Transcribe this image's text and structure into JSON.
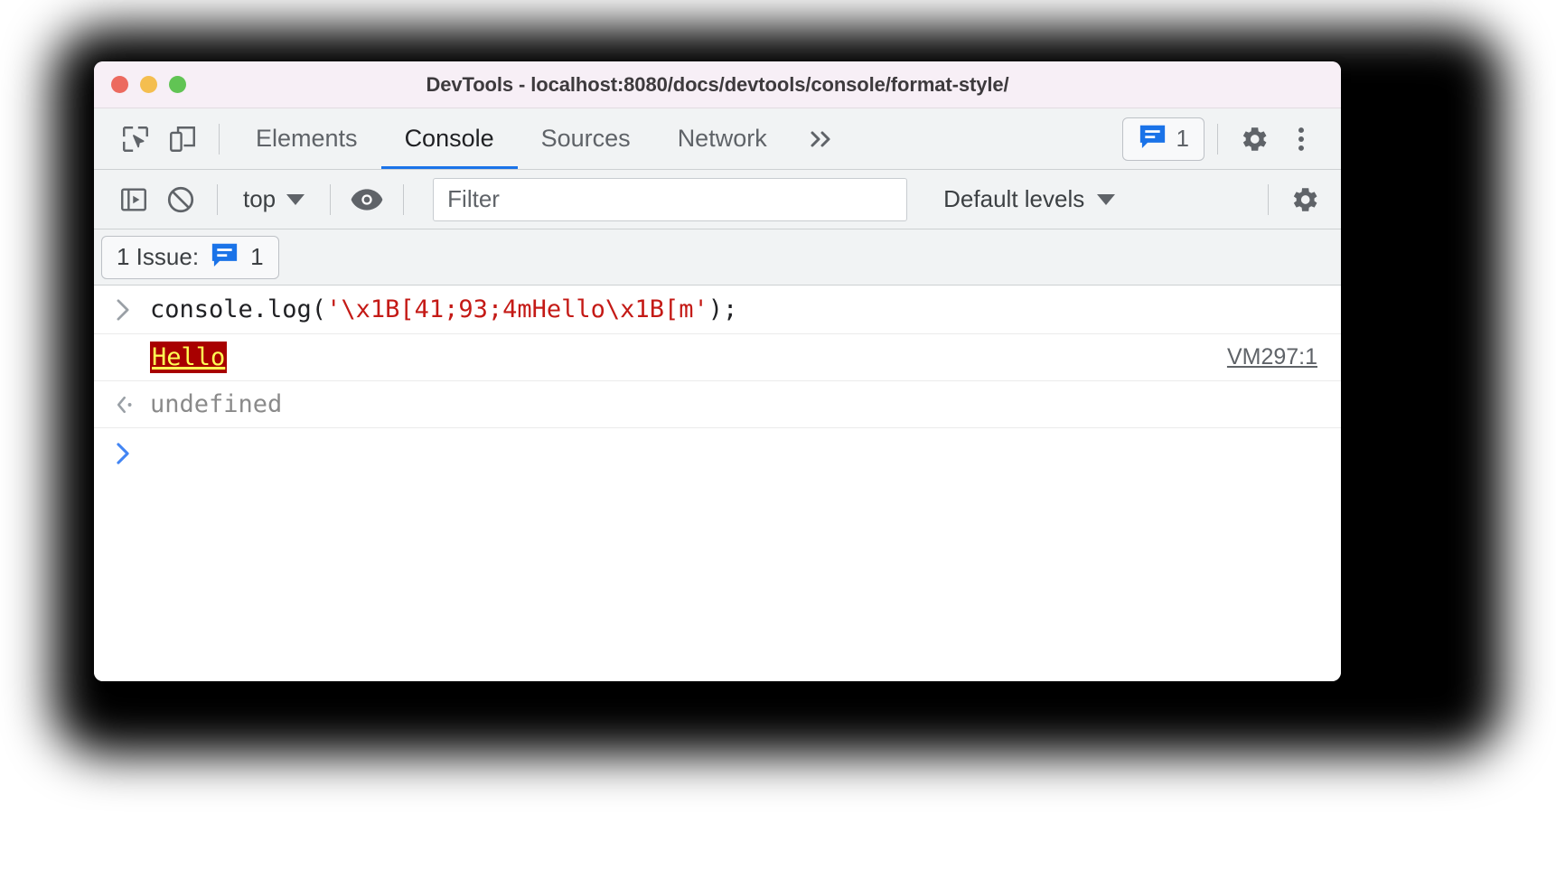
{
  "window": {
    "title": "DevTools - localhost:8080/docs/devtools/console/format-style/",
    "traffic_lights": [
      "close",
      "minimize",
      "maximize"
    ]
  },
  "tabbar": {
    "inspect_icon": "inspect-element-icon",
    "device_icon": "device-toolbar-icon",
    "tabs": [
      {
        "label": "Elements",
        "active": false
      },
      {
        "label": "Console",
        "active": true
      },
      {
        "label": "Sources",
        "active": false
      },
      {
        "label": "Network",
        "active": false
      }
    ],
    "more_tabs_label": "»",
    "issues_badge": {
      "icon": "issues-bubble-icon",
      "count": "1"
    },
    "settings_icon": "gear-icon",
    "menu_icon": "kebab-menu-icon"
  },
  "console_toolbar": {
    "sidebar_toggle_icon": "console-sidebar-icon",
    "clear_console_icon": "clear-console-icon",
    "context_selector": {
      "value": "top",
      "caret": "chevron-down-icon"
    },
    "live_expression_icon": "eye-icon",
    "filter": {
      "value": "",
      "placeholder": "Filter"
    },
    "log_levels": {
      "value": "Default levels",
      "caret": "chevron-down-icon"
    },
    "settings_icon": "gear-icon"
  },
  "issues_bar": {
    "label": "1 Issue:",
    "icon": "issues-bubble-icon",
    "count": "1"
  },
  "console": {
    "entries": [
      {
        "type": "input",
        "prompt": "›",
        "code_prefix": "console.log(",
        "code_string": "'\\x1B[41;93;4mHello\\x1B[m'",
        "code_suffix": ");"
      },
      {
        "type": "output",
        "text": "Hello",
        "fg_color": "#ffff54",
        "bg_color": "#a80000",
        "underline": true,
        "source": "VM297:1"
      },
      {
        "type": "result",
        "prompt": "‹·",
        "text": "undefined"
      }
    ],
    "prompt_symbol": "›"
  }
}
